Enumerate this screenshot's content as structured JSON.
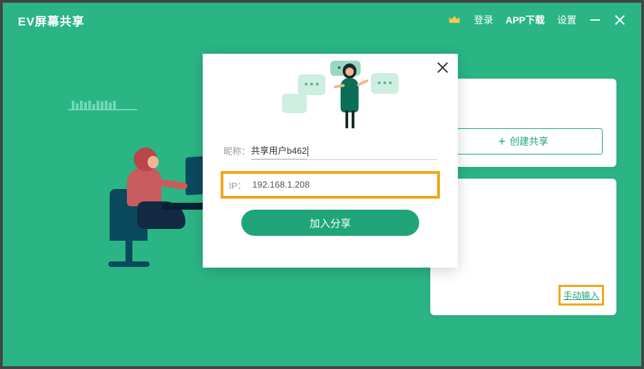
{
  "header": {
    "title": "EV屏幕共享",
    "login": "登录",
    "download": "APP下载",
    "settings": "设置"
  },
  "rightPanel": {
    "createShare": "创建共享",
    "manualInput": "手动输入"
  },
  "modal": {
    "nickLabel": "昵称：",
    "nickValue": "共享用户b462",
    "ipLabel": "IP：",
    "ipValue": "192.168.1.208",
    "joinButton": "加入分享"
  }
}
